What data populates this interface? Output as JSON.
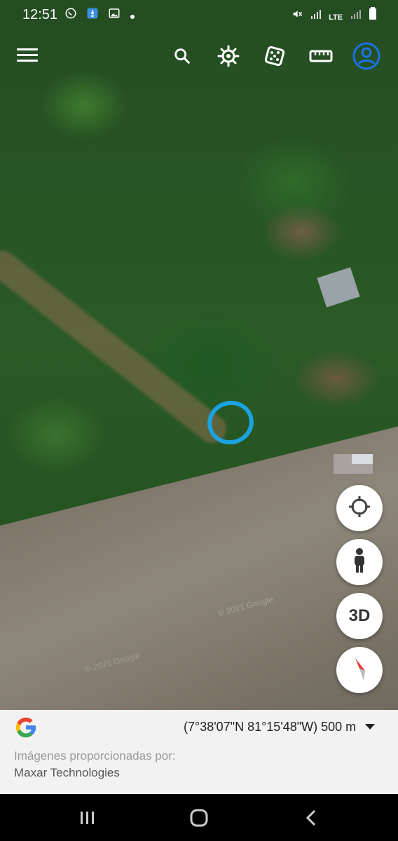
{
  "status_bar": {
    "time": "12:51",
    "left_icons": [
      "whatsapp-icon",
      "app-notification-icon",
      "gallery-icon",
      "dot-icon"
    ],
    "right_icons": [
      "mute-icon",
      "signal-icon",
      "lte-icon",
      "signal-icon-2",
      "battery-icon"
    ],
    "lte_label": "LTE"
  },
  "toolbar": {
    "items": [
      "menu-icon",
      "search-icon",
      "voyager-wheel-icon",
      "feeling-lucky-dice-icon",
      "measure-ruler-icon",
      "account-icon"
    ]
  },
  "map": {
    "watermark": "© 2021 Google",
    "watermark2": "© 2021 Google",
    "accent_color": "#1aa3e0"
  },
  "controls": {
    "my_location": "crosshair-icon",
    "street_view": "pegman-icon",
    "three_d_label": "3D",
    "compass": "compass-icon"
  },
  "bottom": {
    "coords": "(7°38'07\"N 81°15'48\"W) 500 m",
    "credit_label": "Imágenes proporcionadas por:",
    "credit_value": "Maxar Technologies"
  },
  "navbar": {
    "buttons": [
      "recent-apps-icon",
      "home-icon",
      "back-icon"
    ]
  }
}
